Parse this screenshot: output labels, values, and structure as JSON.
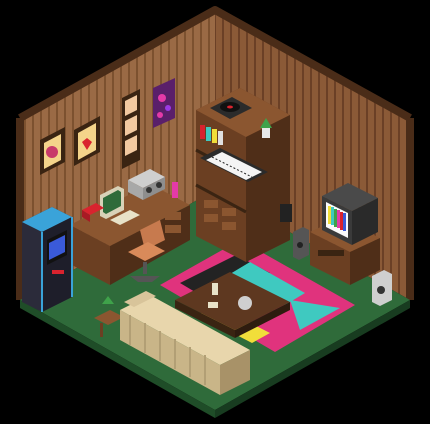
{
  "scene": {
    "palette": {
      "background": "#000000",
      "wall_light": "#9a6a45",
      "wall_dark": "#7a4e30",
      "wall_stripe": "#5e3a22",
      "floor_green": "#2f6b3a",
      "floor_green_dark": "#1f4d28",
      "rug_pink": "#e0337d",
      "rug_teal": "#3fc9c0",
      "rug_yellow": "#f1de3a",
      "rug_black": "#232323",
      "wood": "#6b3f22",
      "wood_light": "#8b5630",
      "sofa": "#d8c49a",
      "arcade_blue": "#3aa3d9",
      "arcade_body": "#2b2b3a",
      "tv_body": "#3a3a3a"
    },
    "objects": [
      "arcade-cabinet",
      "desk",
      "computer",
      "boombox",
      "red-telephone",
      "office-chair",
      "bookshelf",
      "record-player",
      "synth-keyboard",
      "crt-television",
      "tv-stand",
      "speaker-left",
      "speaker-right",
      "coffee-table",
      "sofa",
      "rug",
      "wall-frame-1",
      "wall-frame-2",
      "wall-frame-3",
      "wall-poster"
    ]
  }
}
